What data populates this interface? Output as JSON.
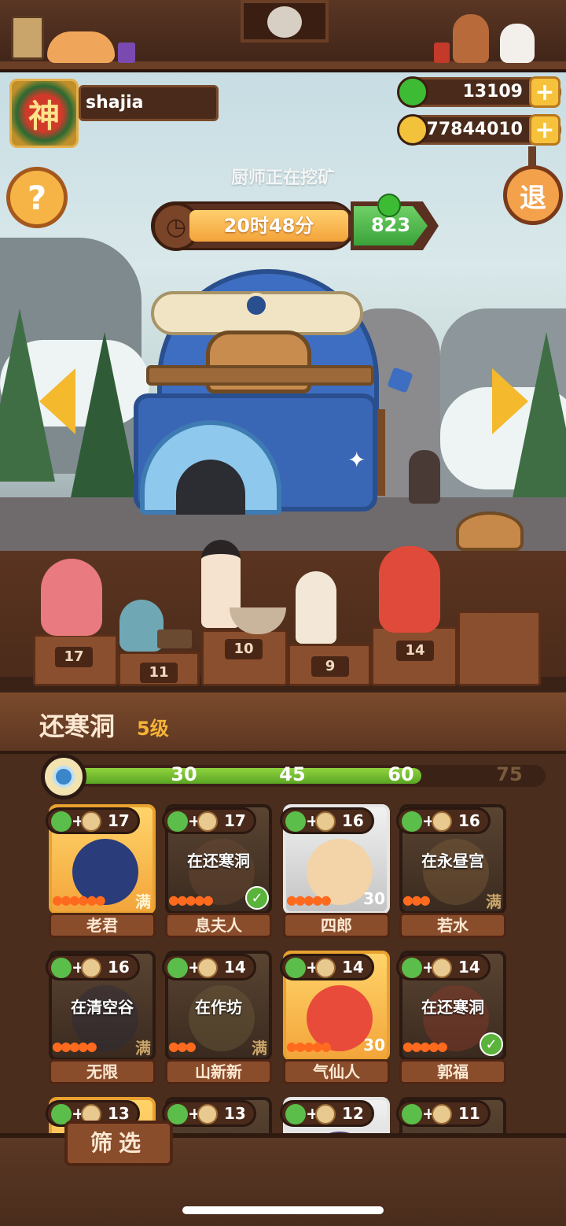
{
  "player": {
    "avatar_glyph": "神",
    "name": "shajia"
  },
  "resources": {
    "green": {
      "icon": "green-apple-icon",
      "value": "13109",
      "color": "#3dbb34"
    },
    "coins": {
      "icon": "copper-coin-icon",
      "value": "77844010",
      "color": "#f2c23a"
    }
  },
  "buttons": {
    "help": "?",
    "exit": "退",
    "plus": "+",
    "filter": "筛选"
  },
  "scene": {
    "status": "厨师正在挖矿",
    "timer": "20时48分",
    "speedup_value": "823"
  },
  "stage": {
    "pedestal_numbers": [
      "17",
      "11",
      "10",
      "9",
      "14"
    ]
  },
  "building": {
    "name": "还寒洞",
    "level": "5级",
    "progress_marks": [
      "30",
      "45",
      "60",
      "75"
    ],
    "progress_fraction": 0.75
  },
  "chefs": [
    {
      "bonus": "17",
      "name": "老君",
      "frame": "gold",
      "status": "",
      "badge": "满",
      "badge_type": "full-light",
      "flames": 6,
      "face_color": "#2b3c7a"
    },
    {
      "bonus": "17",
      "name": "息夫人",
      "frame": "dim",
      "status": "在还寒洞",
      "badge": "",
      "badge_type": "check",
      "flames": 5,
      "face_color": "#6b4a32"
    },
    {
      "bonus": "16",
      "name": "四郎",
      "frame": "silver",
      "status": "",
      "badge": "30",
      "badge_type": "level",
      "flames": 5,
      "face_color": "#f2d4a8"
    },
    {
      "bonus": "16",
      "name": "若水",
      "frame": "dim",
      "status": "在永昼宫",
      "badge": "满",
      "badge_type": "full",
      "flames": 3,
      "face_color": "#7a5a3a"
    },
    {
      "bonus": "16",
      "name": "无限",
      "frame": "dim",
      "status": "在清空谷",
      "badge": "满",
      "badge_type": "full",
      "flames": 5,
      "face_color": "#2a2a3a"
    },
    {
      "bonus": "14",
      "name": "山新新",
      "frame": "dim",
      "status": "在作坊",
      "badge": "满",
      "badge_type": "full",
      "flames": 3,
      "face_color": "#6b5a3a"
    },
    {
      "bonus": "14",
      "name": "气仙人",
      "frame": "gold",
      "status": "",
      "badge": "30",
      "badge_type": "level",
      "flames": 5,
      "face_color": "#e94b3a"
    },
    {
      "bonus": "14",
      "name": "郭福",
      "frame": "dim",
      "status": "在还寒洞",
      "badge": "",
      "badge_type": "check",
      "flames": 5,
      "face_color": "#8a3a2a"
    },
    {
      "bonus": "13",
      "name": "",
      "frame": "gold",
      "status": "",
      "badge": "",
      "badge_type": "",
      "flames": 0,
      "face_color": "#2a2a3a"
    },
    {
      "bonus": "13",
      "name": "",
      "frame": "dim",
      "status": "",
      "badge": "",
      "badge_type": "",
      "flames": 0,
      "face_color": "#4a3a2a"
    },
    {
      "bonus": "12",
      "name": "",
      "frame": "silver",
      "status": "",
      "badge": "",
      "badge_type": "",
      "flames": 0,
      "face_color": "#4a3a6a"
    },
    {
      "bonus": "11",
      "name": "",
      "frame": "dim",
      "status": "",
      "badge": "",
      "badge_type": "",
      "flames": 0,
      "face_color": "#4a3a2a"
    }
  ],
  "colors": {
    "accent": "#f6b437",
    "panel": "#4a2d1d",
    "progress": "#7ccb35"
  }
}
